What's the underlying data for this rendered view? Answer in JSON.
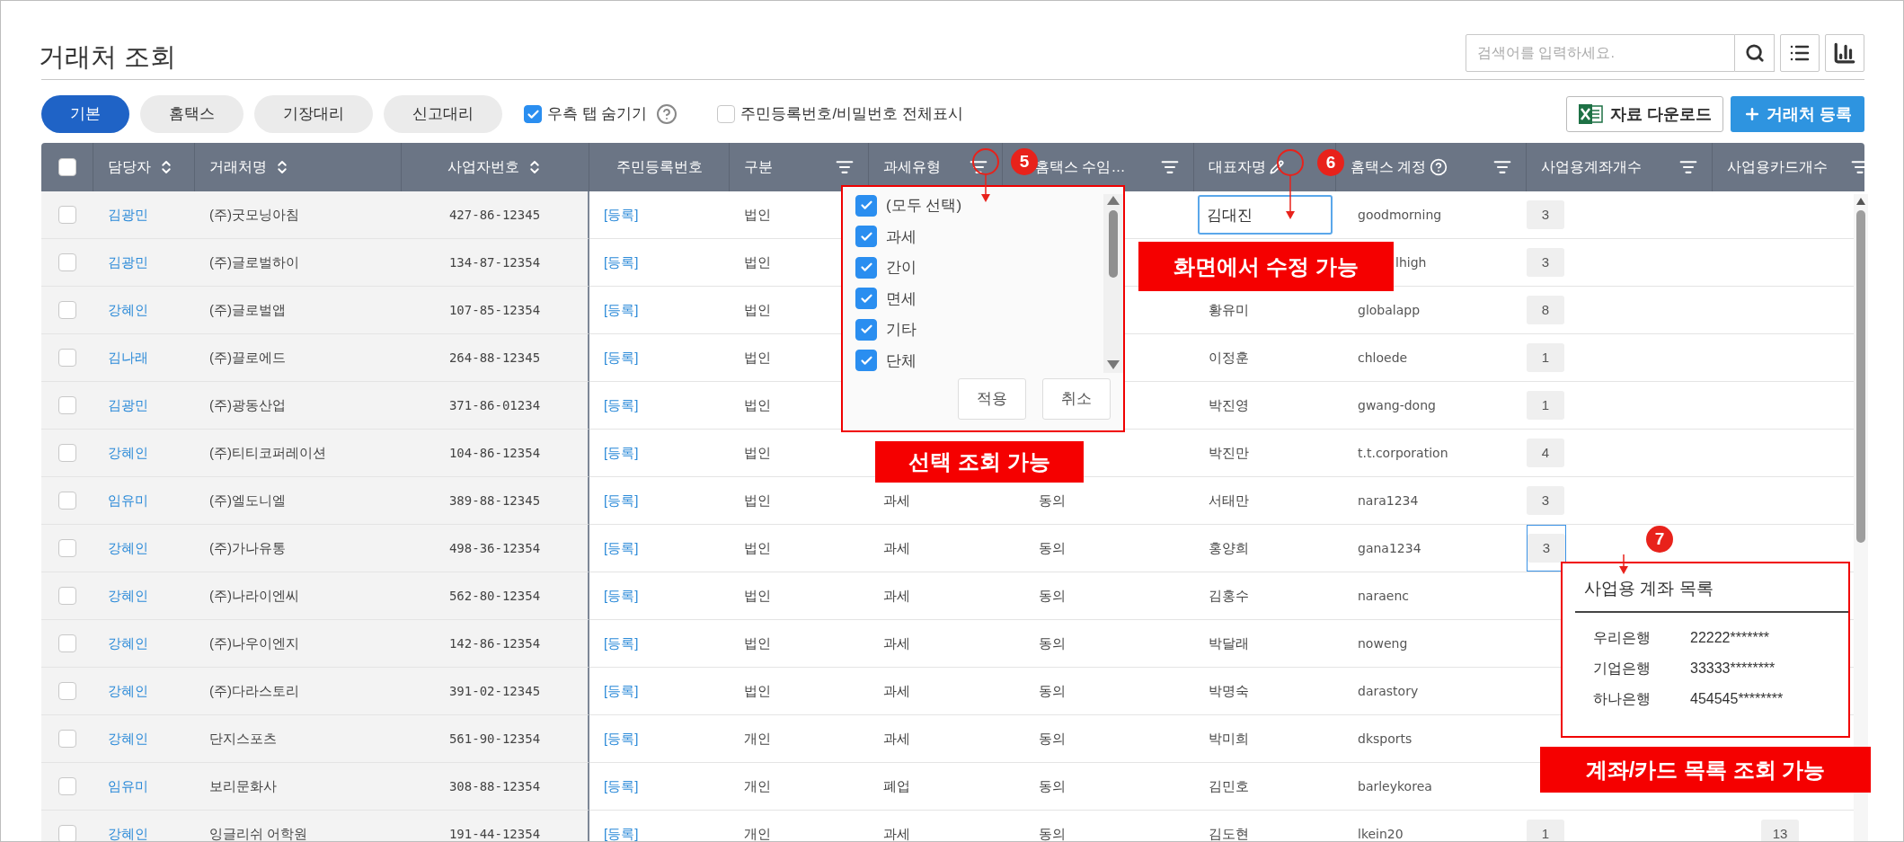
{
  "page_title": "거래처 조회",
  "search": {
    "placeholder": "검색어를 입력하세요."
  },
  "tabs": [
    {
      "label": "기본",
      "selected": true
    },
    {
      "label": "홈택스",
      "selected": false
    },
    {
      "label": "기장대리",
      "selected": false
    },
    {
      "label": "신고대리",
      "selected": false
    }
  ],
  "options": [
    {
      "label": "우측 탭 숨기기",
      "checked": true,
      "help": true
    },
    {
      "label": "주민등록번호/비밀번호 전체표시",
      "checked": false,
      "help": false
    }
  ],
  "actions": [
    {
      "kind": "excel",
      "label": "자료 다운로드"
    },
    {
      "kind": "primary",
      "label": "거래처 등록"
    }
  ],
  "table": {
    "header_checked": false,
    "columns": [
      {
        "label": "담당자",
        "kind": "sort"
      },
      {
        "label": "거래처명",
        "kind": "sort"
      },
      {
        "label": "사업자번호",
        "kind": "sort"
      },
      {
        "label": "주민등록번호",
        "kind": "plain"
      },
      {
        "label": "구분",
        "kind": "filter"
      },
      {
        "label": "과세유형",
        "kind": "filter"
      },
      {
        "label": "홈택스 수임…",
        "kind": "filter"
      },
      {
        "label": "대표자명",
        "kind": "edit"
      },
      {
        "label": "홈택스 계정",
        "kind": "helpfilter"
      },
      {
        "label": "사업용계좌개수",
        "kind": "filter"
      },
      {
        "label": "사업용카드개수",
        "kind": "filter"
      }
    ],
    "rows": [
      {
        "checked": false,
        "manager": "김광민",
        "company": "(주)굿모닝아침",
        "biz_no": "427-86-12345",
        "resident": "[등록]",
        "type": "법인",
        "ceo": "김대진",
        "ceo_editing": true,
        "account": "goodmorning",
        "account_count": "3"
      },
      {
        "checked": false,
        "manager": "김광민",
        "company": "(주)글로벌하이",
        "biz_no": "134-87-12354",
        "resident": "[등록]",
        "type": "법인",
        "account": "lhigh",
        "account_covered": true,
        "account_count": "3"
      },
      {
        "checked": false,
        "manager": "강혜인",
        "company": "(주)글로벌앱",
        "biz_no": "107-85-12354",
        "resident": "[등록]",
        "type": "법인",
        "ceo": "황유미",
        "account": "globalapp",
        "account_count": "8"
      },
      {
        "checked": false,
        "manager": "김나래",
        "company": "(주)끌로에드",
        "biz_no": "264-88-12345",
        "resident": "[등록]",
        "type": "법인",
        "ceo": "이정훈",
        "account": "chloede",
        "account_count": "1"
      },
      {
        "checked": false,
        "manager": "김광민",
        "company": "(주)광동산업",
        "biz_no": "371-86-01234",
        "resident": "[등록]",
        "type": "법인",
        "ceo": "박진영",
        "account": "gwang-dong",
        "account_count": "1"
      },
      {
        "checked": false,
        "manager": "강혜인",
        "company": "(주)티티코퍼레이션",
        "biz_no": "104-86-12354",
        "resident": "[등록]",
        "type": "법인",
        "ceo": "박진만",
        "account": "t.t.corporation",
        "account_count": "4"
      },
      {
        "checked": false,
        "manager": "임유미",
        "company": "(주)엘도니엘",
        "biz_no": "389-88-12345",
        "resident": "[등록]",
        "type": "법인",
        "tax_type": "과세",
        "consent": "동의",
        "ceo": "서태만",
        "account": "nara1234",
        "account_count": "3"
      },
      {
        "checked": false,
        "manager": "강혜인",
        "company": "(주)가나유통",
        "biz_no": "498-36-12354",
        "resident": "[등록]",
        "type": "법인",
        "tax_type": "과세",
        "consent": "동의",
        "ceo": "홍양희",
        "account": "gana1234",
        "account_count": "3",
        "count_selected": true
      },
      {
        "checked": false,
        "manager": "강혜인",
        "company": "(주)나라이엔씨",
        "biz_no": "562-80-12354",
        "resident": "[등록]",
        "type": "법인",
        "tax_type": "과세",
        "consent": "동의",
        "ceo": "김홍수",
        "account": "naraenc"
      },
      {
        "checked": false,
        "manager": "강혜인",
        "company": "(주)나우이엔지",
        "biz_no": "142-86-12354",
        "resident": "[등록]",
        "type": "법인",
        "tax_type": "과세",
        "consent": "동의",
        "ceo": "박달래",
        "account": "noweng"
      },
      {
        "checked": false,
        "manager": "강혜인",
        "company": "(주)다라스토리",
        "biz_no": "391-02-12345",
        "resident": "[등록]",
        "type": "법인",
        "tax_type": "과세",
        "consent": "동의",
        "ceo": "박명숙",
        "account": "darastory"
      },
      {
        "checked": false,
        "manager": "강혜인",
        "company": "단지스포츠",
        "biz_no": "561-90-12354",
        "resident": "[등록]",
        "type": "개인",
        "tax_type": "과세",
        "consent": "동의",
        "ceo": "박미희",
        "account": "dksports"
      },
      {
        "checked": false,
        "manager": "임유미",
        "company": "보리문화사",
        "biz_no": "308-88-12354",
        "resident": "[등록]",
        "type": "개인",
        "tax_type": "폐업",
        "consent": "동의",
        "ceo": "김민호",
        "account": "barleykorea"
      },
      {
        "checked": false,
        "manager": "강혜인",
        "company": "잉글리쉬 어학원",
        "biz_no": "191-44-12354",
        "resident": "[등록]",
        "type": "개인",
        "tax_type": "과세",
        "consent": "동의",
        "ceo": "김도현",
        "account": "lkein20",
        "account_count": "1",
        "card_count": "13"
      }
    ]
  },
  "filter_dropdown": {
    "items": [
      {
        "label": "(모두 선택)",
        "checked": true
      },
      {
        "label": "과세",
        "checked": true
      },
      {
        "label": "간이",
        "checked": true
      },
      {
        "label": "면세",
        "checked": true
      },
      {
        "label": "기타",
        "checked": true
      },
      {
        "label": "단체",
        "checked": true
      }
    ],
    "buttons": [
      "적용",
      "취소"
    ]
  },
  "account_popup": {
    "title": "사업용 계좌 목록",
    "accounts": [
      {
        "bank": "우리은행",
        "number": "22222*******"
      },
      {
        "bank": "기업은행",
        "number": "33333********"
      },
      {
        "bank": "하나은행",
        "number": "454545********"
      }
    ]
  },
  "annotations": [
    {
      "badge": "5",
      "note": "선택 조회 가능"
    },
    {
      "badge": "6",
      "note": "화면에서 수정 가능"
    },
    {
      "badge": "7",
      "note": "계좌/카드 목록 조회 가능"
    }
  ]
}
